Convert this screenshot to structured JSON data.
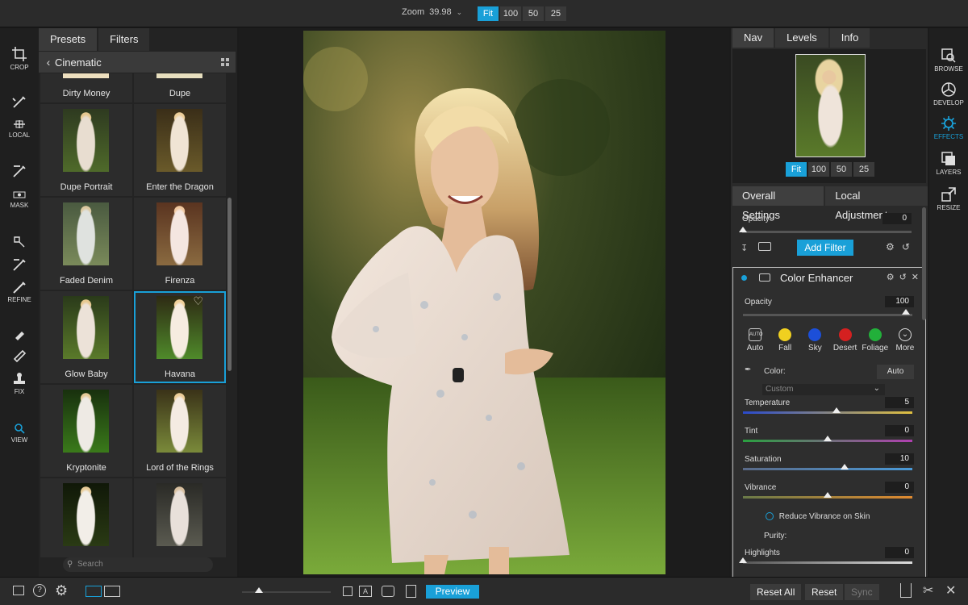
{
  "topbar": {
    "zoom_label": "Zoom",
    "zoom_value": "39.98",
    "zoom_buttons": [
      "Fit",
      "100",
      "50",
      "25"
    ]
  },
  "left_tools": [
    {
      "label": "CROP",
      "icon": "crop-icon"
    },
    {
      "label": "",
      "icon": "brush-icon"
    },
    {
      "label": "LOCAL",
      "icon": "local-icon"
    },
    {
      "label": "",
      "icon": "mask-brush-icon"
    },
    {
      "label": "MASK",
      "icon": "mask-icon"
    },
    {
      "label": "",
      "icon": "refine-brush-icon"
    },
    {
      "label": "REFINE",
      "icon": "refine-icon"
    },
    {
      "label": "FIX",
      "icon": "stamp-icon"
    },
    {
      "label": "VIEW",
      "icon": "magnifier-icon"
    }
  ],
  "presets": {
    "tabs": [
      "Presets",
      "Filters"
    ],
    "category": "Cinematic",
    "items": [
      {
        "label": "Dirty Money"
      },
      {
        "label": "Dupe"
      },
      {
        "label": "Dupe Portrait"
      },
      {
        "label": "Enter the Dragon"
      },
      {
        "label": "Faded Denim"
      },
      {
        "label": "Firenza"
      },
      {
        "label": "Glow Baby"
      },
      {
        "label": "Havana"
      },
      {
        "label": "Kryptonite"
      },
      {
        "label": "Lord of the Rings"
      },
      {
        "label": ""
      },
      {
        "label": ""
      }
    ],
    "selected": "Havana",
    "search_placeholder": "Search"
  },
  "nav": {
    "tabs": [
      "Nav",
      "Levels",
      "Info"
    ],
    "zoom_buttons": [
      "Fit",
      "100",
      "50",
      "25"
    ]
  },
  "settings": {
    "tabs": [
      "Overall Settings",
      "Local Adjustments"
    ],
    "opacity_label": "Opacity",
    "opacity_value": "0",
    "add_filter": "Add Filter"
  },
  "color_enhancer": {
    "title": "Color Enhancer",
    "opacity_label": "Opacity",
    "opacity_value": "100",
    "presets": [
      {
        "label": "Auto",
        "color": "#dddddd"
      },
      {
        "label": "Fall",
        "color": "#f0d020"
      },
      {
        "label": "Sky",
        "color": "#1c4fd8"
      },
      {
        "label": "Desert",
        "color": "#d42020"
      },
      {
        "label": "Foliage",
        "color": "#22b03a"
      },
      {
        "label": "More",
        "color": "#dddddd"
      }
    ],
    "color_label": "Color:",
    "auto_button": "Auto",
    "custom_select": "Custom",
    "sliders": [
      {
        "label": "Temperature",
        "value": "5",
        "level": 0.55
      },
      {
        "label": "Tint",
        "value": "0",
        "level": 0.5
      },
      {
        "label": "Saturation",
        "value": "10",
        "level": 0.6
      },
      {
        "label": "Vibrance",
        "value": "0",
        "level": 0.5
      }
    ],
    "reduce_vibrance": "Reduce Vibrance on Skin",
    "purity_label": "Purity:",
    "highlights_label": "Highlights",
    "highlights_value": "0"
  },
  "right_modules": [
    {
      "label": "BROWSE",
      "icon": "browse-icon"
    },
    {
      "label": "DEVELOP",
      "icon": "develop-icon"
    },
    {
      "label": "EFFECTS",
      "icon": "effects-icon",
      "active": true
    },
    {
      "label": "LAYERS",
      "icon": "layers-icon"
    },
    {
      "label": "RESIZE",
      "icon": "resize-icon"
    }
  ],
  "bottombar": {
    "preview": "Preview",
    "reset_all": "Reset All",
    "reset": "Reset",
    "sync": "Sync"
  },
  "colors": {
    "accent": "#19a0d8"
  }
}
